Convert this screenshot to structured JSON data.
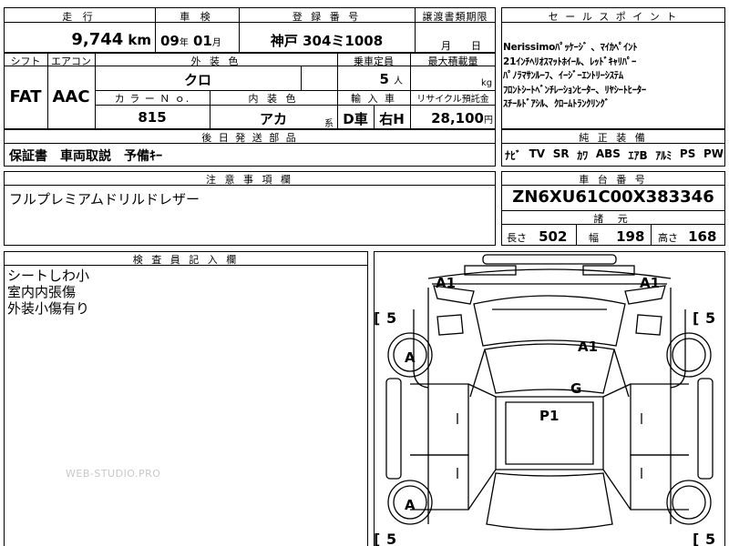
{
  "top": {
    "mileage_label": "走 行",
    "mileage_value": "9,744",
    "mileage_unit": "km",
    "inspection_label": "車 検",
    "inspection_year": "09",
    "inspection_year_unit": "年",
    "inspection_month": "01",
    "inspection_month_unit": "月",
    "reg_label": "登 録 番 号",
    "reg_value": "神戸 304ミ1008",
    "transfer_label": "譲渡書類期限",
    "transfer_unit": "月　　日"
  },
  "specs": {
    "shift_label": "シフト",
    "shift_value": "FAT",
    "ac_label": "エアコン",
    "ac_value": "AAC",
    "exterior_label": "外 装 色",
    "exterior_value": "クロ",
    "capacity_label": "乗車定員",
    "capacity_value": "5",
    "capacity_unit": "人",
    "load_label": "最大積載量",
    "load_unit": "kg",
    "color_no_label": "カ ラ ー Ｎ ｏ.",
    "color_no_value": "815",
    "interior_label": "内 装 色",
    "interior_value": "アカ",
    "interior_suffix": "系",
    "import_label": "輸 入 車",
    "import_value": "D車",
    "steering_value": "右H",
    "recycle_label": "リサイクル預託金",
    "recycle_value": "28,100",
    "recycle_unit": "円"
  },
  "selling_points": {
    "label": "セ ー ル ス ポ イ ン ト",
    "items": [
      "Nerissimoﾊﾟｯｹｰｼﾞ 、ﾏｲｶﾍﾟｲﾝﾄ",
      "21ｲﾝﾁﾍﾘｵｽﾏｯﾄﾎｲｰﾙ、ﾚｯﾄﾞｷｬﾘﾊﾟｰ",
      "ﾊﾟﾉﾗﾏｻﾝﾙｰﾌ、ｲｰｼﾞｰｴﾝﾄﾘｰｼｽﾃﾑ",
      "ﾌﾛﾝﾄｼｰﾄﾍﾞﾝﾁﾚｰｼｮﾝﾋｰﾀｰ、ﾘﾔｼｰﾄﾋｰﾀｰ",
      "ｽﾁｰﾙﾄﾞｱｼﾙ、ｸﾛｰﾑﾄﾗﾝｸﾘﾝｸﾞ"
    ]
  },
  "parts": {
    "label": "後 日 発 送 部 品",
    "value": "保証書　車両取説　予備ｷｰ"
  },
  "equipment": {
    "label": "純 正 装 備",
    "items": [
      "ﾅﾋﾞ",
      "TV",
      "SR",
      "ｶﾜ",
      "ABS",
      "ｴｱB",
      "ｱﾙﾐ",
      "PS",
      "PW"
    ]
  },
  "notes": {
    "label": "注 意 事 項 欄",
    "value": "フルプレミアムドリルドレザー"
  },
  "chassis": {
    "label": "車 台 番 号",
    "value": "ZN6XU61C00X383346"
  },
  "dimensions": {
    "label": "諸 元",
    "length_label": "長さ",
    "length_value": "502",
    "width_label": "幅",
    "width_value": "198",
    "height_label": "高さ",
    "height_value": "168"
  },
  "inspector": {
    "label": "検 査 員 記 入 欄",
    "lines": [
      "シートしわ小",
      "室内内張傷",
      "外装小傷有り"
    ]
  },
  "watermark": "WEB-STUDIO.PRO",
  "diagram": {
    "marks": {
      "front_left": "A1",
      "front_right": "A1",
      "hood": "A1",
      "roof": "G",
      "cabin": "P1",
      "wheel_front_left": "A",
      "wheel_rear_left": "A"
    },
    "tire_depths": [
      "5",
      "5",
      "5",
      "5"
    ],
    "bracket_open": "[",
    "bracket_close": "["
  }
}
